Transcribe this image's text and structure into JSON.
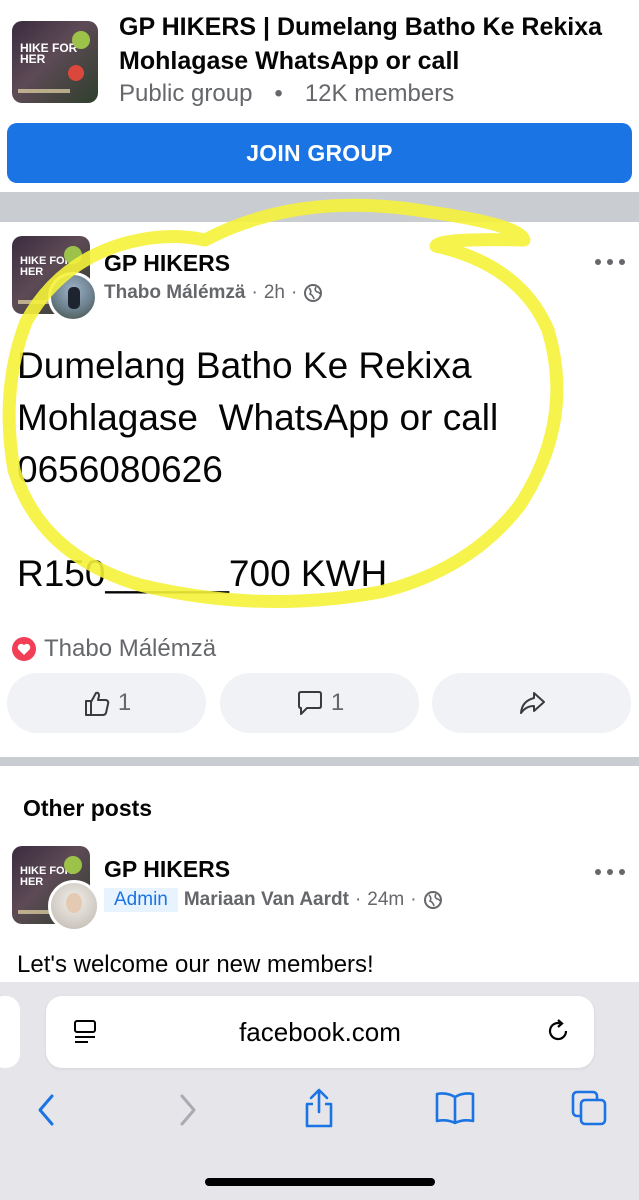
{
  "group": {
    "title": "GP HIKERS | Dumelang Batho Ke Rekixa Mohlagase  WhatsApp or call",
    "privacy": "Public group",
    "members": "12K members",
    "join_label": "JOIN GROUP",
    "thumb_text": "HIKE FOR HER"
  },
  "post": {
    "group_name": "GP HIKERS",
    "author": "Thabo Málémzä",
    "time": "2h",
    "text": "Dumelang Batho Ke Rekixa Mohlagase  WhatsApp or call 0656080626\n\nR150______700 KWH",
    "reaction_name": "Thabo Málémzä",
    "like_count": "1",
    "comment_count": "1"
  },
  "other_posts": {
    "heading": "Other posts",
    "group_name": "GP HIKERS",
    "badge": "Admin",
    "author": "Mariaan Van Aardt",
    "time": "24m",
    "text": "Let's welcome our new members!"
  },
  "browser": {
    "url": "facebook.com"
  },
  "colors": {
    "brand_blue": "#1b74e4",
    "highlight": "#f5f23a",
    "heart": "#f33e58"
  }
}
